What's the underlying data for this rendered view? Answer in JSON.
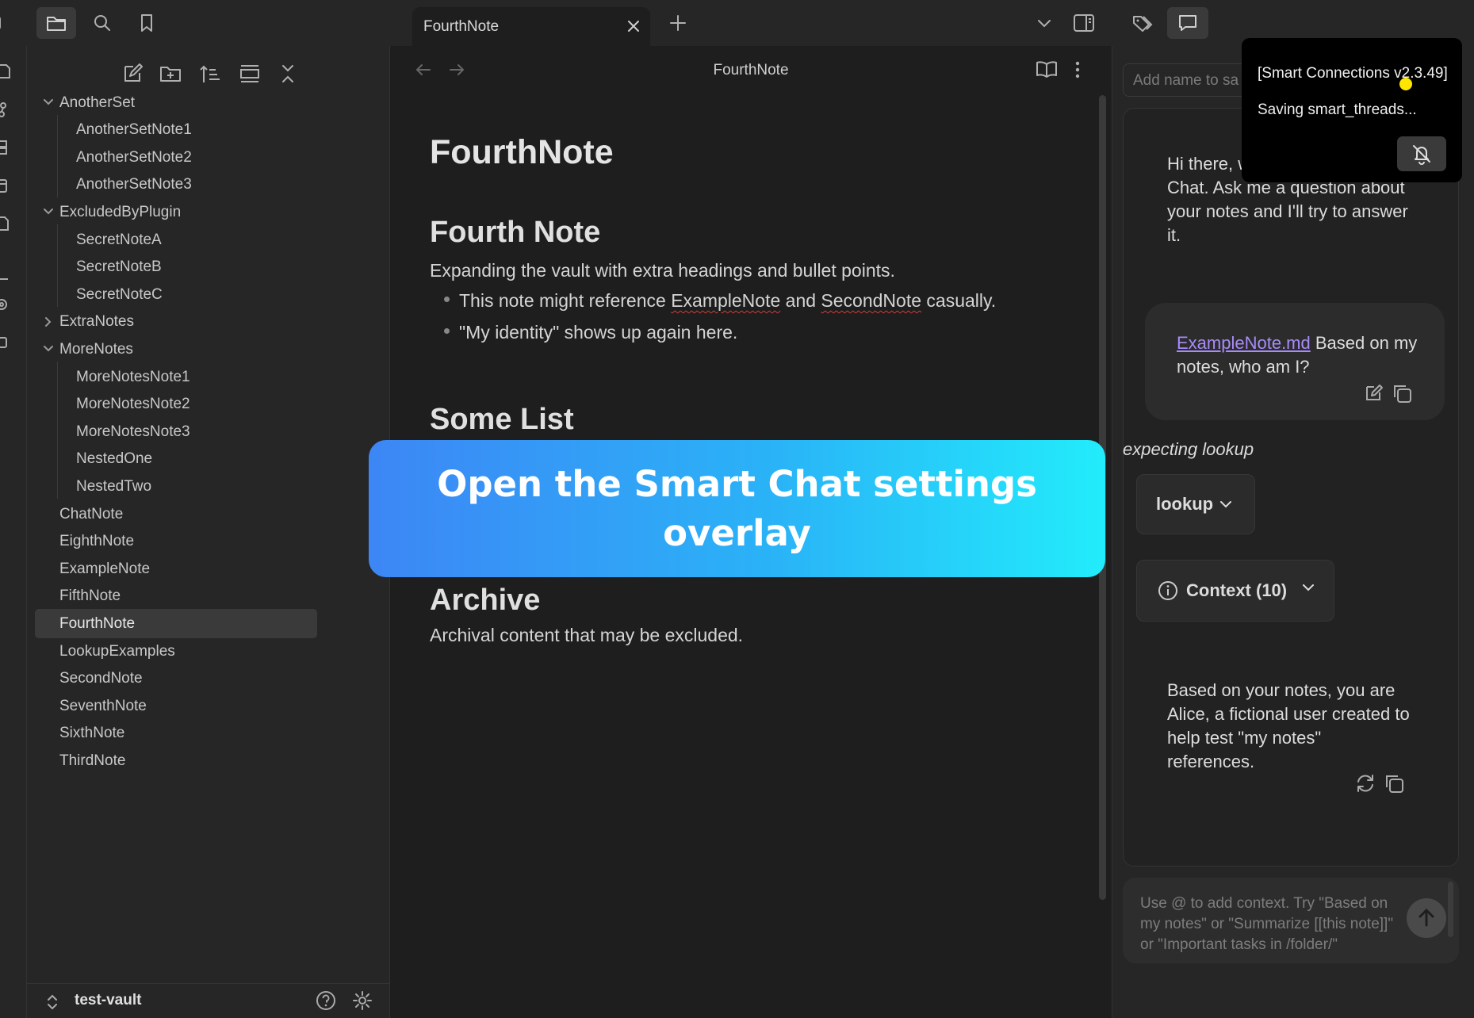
{
  "tab": {
    "title": "FourthNote"
  },
  "editor": {
    "view_title": "FourthNote",
    "note_title": "FourthNote",
    "heading_fourth": "Fourth Note",
    "intro": "Expanding the vault with extra headings and bullet points.",
    "bullet1": {
      "pre": "This note might reference ",
      "link1": "ExampleNote",
      "mid": " and ",
      "link2": "SecondNote",
      "post": " casually."
    },
    "bullet2": "\"My identity\" shows up again here.",
    "heading_list": "Some List",
    "heading_archive": "Archive",
    "archive_text": "Archival content that may be excluded."
  },
  "sidebar": {
    "tree": [
      {
        "label": "AnotherSet",
        "type": "folder",
        "expanded": true
      },
      {
        "label": "AnotherSetNote1",
        "type": "file",
        "depth": 1
      },
      {
        "label": "AnotherSetNote2",
        "type": "file",
        "depth": 1
      },
      {
        "label": "AnotherSetNote3",
        "type": "file",
        "depth": 1
      },
      {
        "label": "ExcludedByPlugin",
        "type": "folder",
        "expanded": true
      },
      {
        "label": "SecretNoteA",
        "type": "file",
        "depth": 1
      },
      {
        "label": "SecretNoteB",
        "type": "file",
        "depth": 1
      },
      {
        "label": "SecretNoteC",
        "type": "file",
        "depth": 1
      },
      {
        "label": "ExtraNotes",
        "type": "folder",
        "expanded": false
      },
      {
        "label": "MoreNotes",
        "type": "folder",
        "expanded": true
      },
      {
        "label": "MoreNotesNote1",
        "type": "file",
        "depth": 1
      },
      {
        "label": "MoreNotesNote2",
        "type": "file",
        "depth": 1
      },
      {
        "label": "MoreNotesNote3",
        "type": "file",
        "depth": 1
      },
      {
        "label": "NestedOne",
        "type": "file",
        "depth": 1
      },
      {
        "label": "NestedTwo",
        "type": "file",
        "depth": 1
      },
      {
        "label": "ChatNote",
        "type": "file",
        "depth": 0
      },
      {
        "label": "EighthNote",
        "type": "file",
        "depth": 0
      },
      {
        "label": "ExampleNote",
        "type": "file",
        "depth": 0
      },
      {
        "label": "FifthNote",
        "type": "file",
        "depth": 0
      },
      {
        "label": "FourthNote",
        "type": "file",
        "depth": 0,
        "active": true
      },
      {
        "label": "LookupExamples",
        "type": "file",
        "depth": 0
      },
      {
        "label": "SecondNote",
        "type": "file",
        "depth": 0
      },
      {
        "label": "SeventhNote",
        "type": "file",
        "depth": 0
      },
      {
        "label": "SixthNote",
        "type": "file",
        "depth": 0
      },
      {
        "label": "ThirdNote",
        "type": "file",
        "depth": 0
      }
    ],
    "vault_name": "test-vault"
  },
  "chat": {
    "name_placeholder": "Add name to sa",
    "welcome": "Hi there, welcome to the Smart Chat. Ask me a question about your notes and I'll try to answer it.",
    "user_link": "ExampleNote.md",
    "user_text": " Based on my notes, who am I?",
    "expecting": "expecting lookup",
    "lookup_label": "lookup",
    "context_label": "Context (10)",
    "answer": "Based on your notes, you are Alice, a fictional user created to help test \"my notes\" references.",
    "input_placeholder": "Use @ to add context. Try \"Based on my notes\" or \"Summarize [[this note]]\" or \"Important tasks in /folder/\""
  },
  "notice": {
    "line1": "[Smart Connections v2.3.49]",
    "line2": "Saving smart_threads..."
  },
  "banner": {
    "text": "Open the Smart Chat settings overlay"
  },
  "colors": {
    "accent_link": "#a88bfa",
    "banner_start": "#3d86f5",
    "banner_end": "#22ecfb",
    "cursor": "#ffe600"
  }
}
